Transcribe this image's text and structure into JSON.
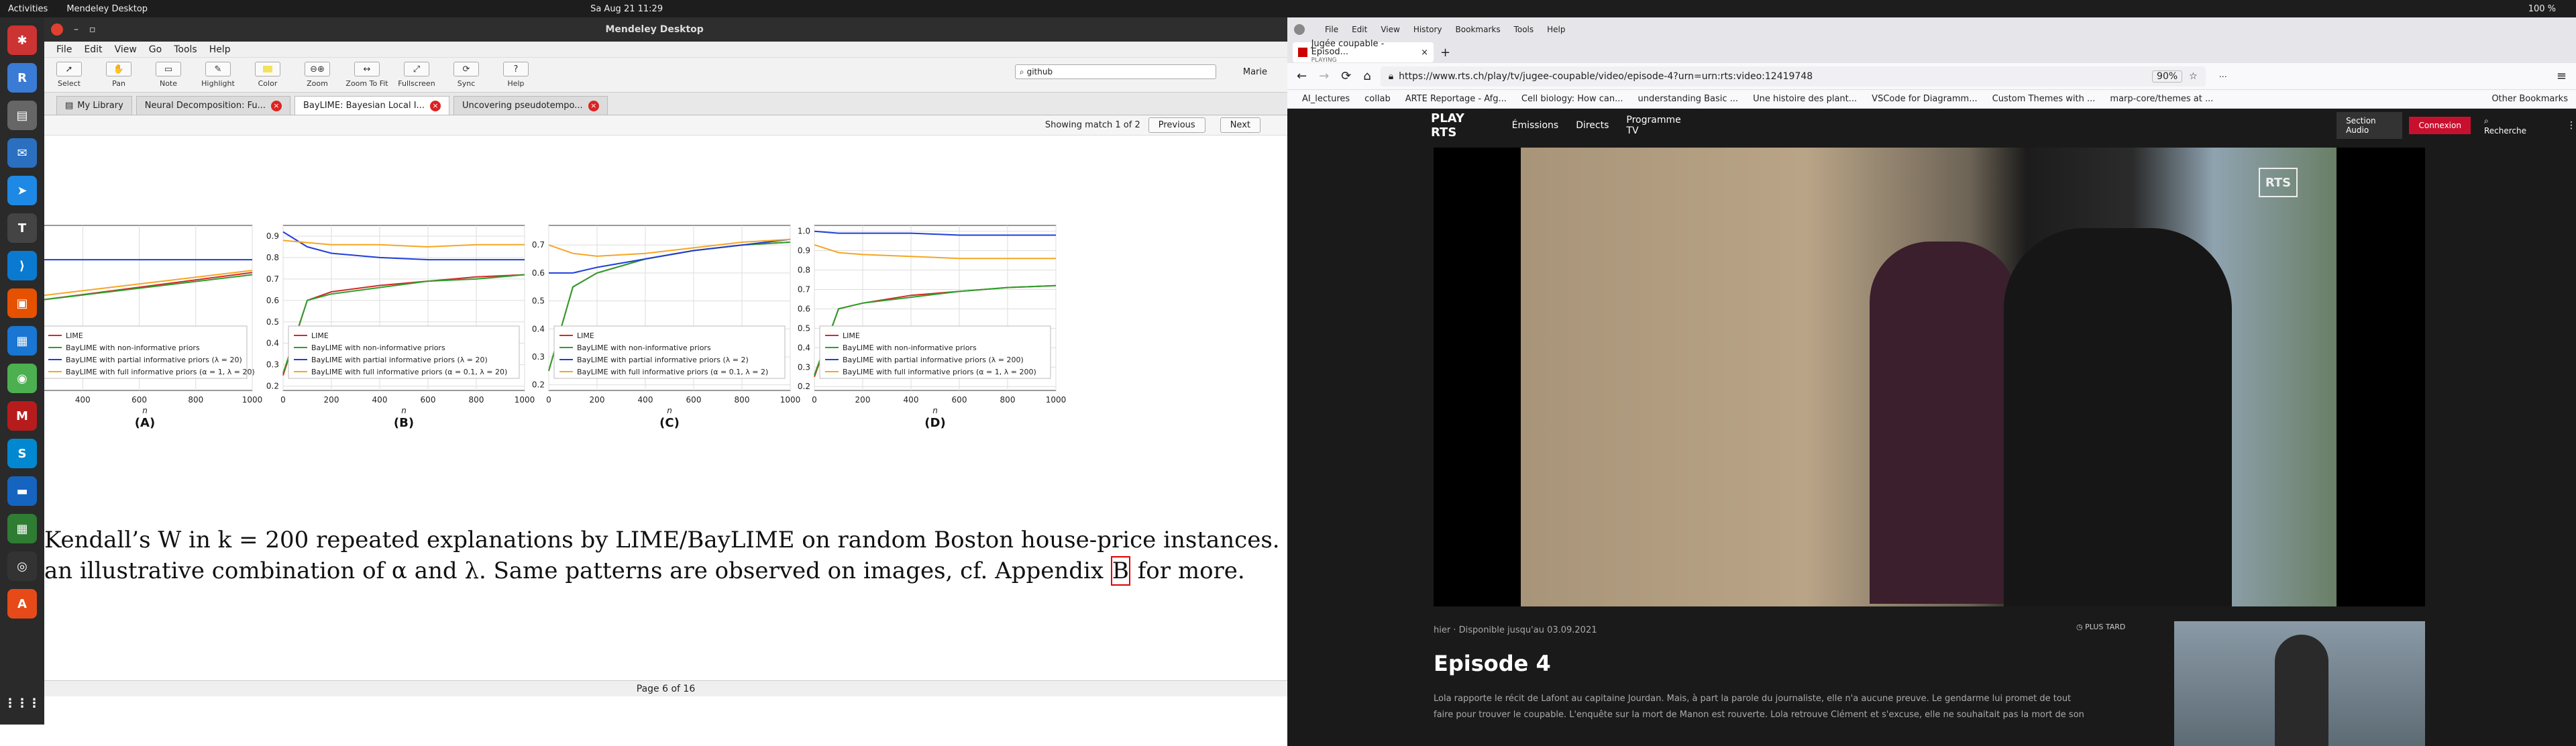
{
  "topbar": {
    "activities": "Activities",
    "app": "Mendeley Desktop",
    "clock": "Sa Aug 21  11:29",
    "battery": "100 %"
  },
  "mendeley": {
    "window_title": "Mendeley Desktop",
    "menu": [
      "File",
      "Edit",
      "View",
      "Go",
      "Tools",
      "Help"
    ],
    "tools": [
      {
        "label": "Select",
        "icon": "arrow"
      },
      {
        "label": "Pan",
        "icon": "hand"
      },
      {
        "label": "Note",
        "icon": "note"
      },
      {
        "label": "Highlight",
        "icon": "pen"
      },
      {
        "label": "Color",
        "icon": "swatch"
      },
      {
        "label": "Zoom",
        "icon": "zoom"
      },
      {
        "label": "Zoom To Fit",
        "icon": "fit"
      },
      {
        "label": "Fullscreen",
        "icon": "full"
      },
      {
        "label": "Sync",
        "icon": "sync"
      },
      {
        "label": "Help",
        "icon": "help"
      }
    ],
    "search": "github",
    "user": "Marie",
    "tabs": [
      "My Library",
      "Neural Decomposition: Fu...",
      "BayLIME: Bayesian Local I...",
      "Uncovering pseudotempo..."
    ],
    "find": {
      "status": "Showing match 1 of 2",
      "prev": "Previous",
      "next": "Next"
    },
    "status": "Page 6 of 16",
    "caption_line1": "Kendall’s W in k = 200 repeated explanations by LIME/BayLIME on random Boston house-price instances. Each",
    "caption_line2_a": "an illustrative combination of α and λ. Same patterns are observed on images, cf. Appendix ",
    "caption_link": "B",
    "caption_line2_b": " for more."
  },
  "chart_data": [
    {
      "type": "line",
      "panel": "(A)",
      "xlabel": "n",
      "xticks": [
        400,
        600,
        800,
        1000
      ],
      "legend": [
        "LIME",
        "BayLIME with non-informative priors",
        "BayLIME with partial informative priors (λ = 20)",
        "BayLIME with full informative priors (α = 1, λ = 20)"
      ],
      "series": [
        {
          "name": "LIME",
          "x": [
            240,
            1000
          ],
          "y": [
            0.6,
            0.73
          ]
        },
        {
          "name": "BayLIME with non-informative priors",
          "x": [
            240,
            1000
          ],
          "y": [
            0.6,
            0.72
          ]
        },
        {
          "name": "BayLIME with partial informative priors (λ = 20)",
          "x": [
            240,
            1000
          ],
          "y": [
            0.79,
            0.79
          ]
        },
        {
          "name": "BayLIME with full informative priors (α = 1, λ = 20)",
          "x": [
            240,
            1000
          ],
          "y": [
            0.62,
            0.74
          ]
        }
      ]
    },
    {
      "type": "line",
      "panel": "(B)",
      "xlabel": "n",
      "xticks": [
        0,
        200,
        400,
        600,
        800,
        1000
      ],
      "yticks": [
        0.2,
        0.3,
        0.4,
        0.5,
        0.6,
        0.7,
        0.8,
        0.9
      ],
      "legend": [
        "LIME",
        "BayLIME with non-informative priors",
        "BayLIME with partial informative priors (λ = 20)",
        "BayLIME with full informative priors (α = 0.1, λ = 20)"
      ],
      "series": [
        {
          "name": "LIME",
          "x": [
            0,
            100,
            200,
            400,
            600,
            800,
            1000
          ],
          "y": [
            0.25,
            0.6,
            0.64,
            0.67,
            0.69,
            0.71,
            0.72
          ]
        },
        {
          "name": "BayLIME with non-informative priors",
          "x": [
            0,
            100,
            200,
            400,
            600,
            800,
            1000
          ],
          "y": [
            0.26,
            0.6,
            0.63,
            0.66,
            0.69,
            0.7,
            0.72
          ]
        },
        {
          "name": "BayLIME with partial informative priors (λ = 20)",
          "x": [
            0,
            100,
            200,
            400,
            600,
            800,
            1000
          ],
          "y": [
            0.92,
            0.85,
            0.82,
            0.8,
            0.79,
            0.79,
            0.79
          ]
        },
        {
          "name": "BayLIME with full informative priors (α = 0.1, λ = 20)",
          "x": [
            0,
            100,
            200,
            400,
            600,
            800,
            1000
          ],
          "y": [
            0.88,
            0.87,
            0.86,
            0.86,
            0.85,
            0.86,
            0.86
          ]
        }
      ]
    },
    {
      "type": "line",
      "panel": "(C)",
      "xlabel": "n",
      "xticks": [
        0,
        200,
        400,
        600,
        800,
        1000
      ],
      "yticks": [
        0.2,
        0.3,
        0.4,
        0.5,
        0.6,
        0.7
      ],
      "legend": [
        "LIME",
        "BayLIME with non-informative priors",
        "BayLIME with partial informative priors (λ = 2)",
        "BayLIME with full informative priors (α = 0.1, λ = 2)"
      ],
      "series": [
        {
          "name": "LIME",
          "x": [
            0,
            100,
            200,
            400,
            600,
            800,
            1000
          ],
          "y": [
            0.25,
            0.55,
            0.6,
            0.65,
            0.68,
            0.7,
            0.71
          ]
        },
        {
          "name": "BayLIME with non-informative priors",
          "x": [
            0,
            100,
            200,
            400,
            600,
            800,
            1000
          ],
          "y": [
            0.25,
            0.55,
            0.6,
            0.65,
            0.68,
            0.7,
            0.71
          ]
        },
        {
          "name": "BayLIME with partial informative priors (λ = 2)",
          "x": [
            0,
            100,
            200,
            400,
            600,
            800,
            1000
          ],
          "y": [
            0.6,
            0.6,
            0.62,
            0.65,
            0.68,
            0.7,
            0.72
          ]
        },
        {
          "name": "BayLIME with full informative priors (α = 0.1, λ = 2)",
          "x": [
            0,
            100,
            200,
            400,
            600,
            800,
            1000
          ],
          "y": [
            0.7,
            0.67,
            0.66,
            0.67,
            0.69,
            0.71,
            0.72
          ]
        }
      ]
    },
    {
      "type": "line",
      "panel": "(D)",
      "xlabel": "n",
      "xticks": [
        0,
        200,
        400,
        600,
        800,
        1000
      ],
      "yticks": [
        0.2,
        0.3,
        0.4,
        0.5,
        0.6,
        0.7,
        0.8,
        0.9,
        1.0
      ],
      "legend": [
        "LIME",
        "BayLIME with non-informative priors",
        "BayLIME with partial informative priors (λ = 200)",
        "BayLIME with full informative priors (α = 1, λ = 200)"
      ],
      "series": [
        {
          "name": "LIME",
          "x": [
            0,
            100,
            200,
            400,
            600,
            800,
            1000
          ],
          "y": [
            0.25,
            0.6,
            0.63,
            0.67,
            0.69,
            0.71,
            0.72
          ]
        },
        {
          "name": "BayLIME with non-informative priors",
          "x": [
            0,
            100,
            200,
            400,
            600,
            800,
            1000
          ],
          "y": [
            0.26,
            0.6,
            0.63,
            0.66,
            0.69,
            0.71,
            0.72
          ]
        },
        {
          "name": "BayLIME with partial informative priors (λ = 200)",
          "x": [
            0,
            100,
            200,
            400,
            600,
            800,
            1000
          ],
          "y": [
            1.0,
            0.99,
            0.99,
            0.99,
            0.98,
            0.98,
            0.98
          ]
        },
        {
          "name": "BayLIME with full informative priors (α = 1, λ = 200)",
          "x": [
            0,
            100,
            200,
            400,
            600,
            800,
            1000
          ],
          "y": [
            0.93,
            0.89,
            0.88,
            0.87,
            0.86,
            0.86,
            0.86
          ]
        }
      ]
    }
  ],
  "colors": {
    "LIME": "#d62728",
    "noninf": "#2ca02c",
    "partial": "#1f3fd6",
    "full": "#f5a623"
  },
  "firefox": {
    "tab_title": "Jugée coupable - Episod...",
    "tab_sub": "PLAYING",
    "url": "https://www.rts.ch/play/tv/jugee-coupable/video/episode-4?urn=urn:rts:video:12419748",
    "zoom": "90%",
    "menu": [
      "File",
      "Edit",
      "View",
      "History",
      "Bookmarks",
      "Tools",
      "Help"
    ],
    "bookmarks": [
      "AI_lectures",
      "collab",
      "ARTE Reportage - Afg...",
      "Cell biology: How can...",
      "understanding Basic ...",
      "Une histoire des plant...",
      "VSCode for Diagramm...",
      "Custom Themes with ...",
      "marp-core/themes at ...",
      "Other Bookmarks"
    ]
  },
  "rts": {
    "logo": "PLAY RTS",
    "nav": [
      "Émissions",
      "Directs",
      "Programme TV"
    ],
    "audio": "Section Audio",
    "login": "Connexion",
    "search": "Recherche",
    "badge": "RTS",
    "meta": "hier · Disponible jusqu'au 03.09.2021",
    "later": "PLUS TARD",
    "title": "Episode 4",
    "desc1": "Lola rapporte le récit de Lafont au capitaine Jourdan. Mais, à part la parole du journaliste, elle n'a aucune preuve. Le gendarme lui promet de tout",
    "desc2": "faire pour trouver le coupable. L'enquête sur la mort de Manon est rouverte. Lola retrouve Clément et s'excuse, elle ne souhaitait pas la mort de son"
  }
}
